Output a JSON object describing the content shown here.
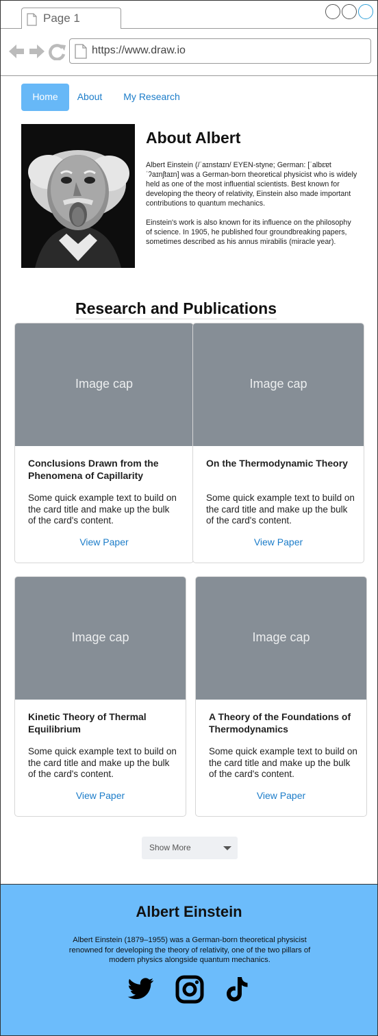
{
  "browser": {
    "tab_label": "Page 1",
    "url": "https://www.draw.io"
  },
  "nav": {
    "items": [
      {
        "label": "Home",
        "active": true
      },
      {
        "label": "About",
        "active": false
      },
      {
        "label": "My Research",
        "active": false
      }
    ]
  },
  "about": {
    "title": "About Albert",
    "paragraph_1": "Albert Einstein (/ˈaɪnstaɪn/ EYEN-styne; German: [ˈalbɛɐt ˈʔaɪnʃtaɪn] was a German-born theoretical physicist who is widely held as one of the most influential scientists. Best known for developing the theory of relativity, Einstein also made important contributions to quantum mechanics.",
    "paragraph_2": "Einstein's work is also known for its influence on the philosophy of science. In 1905, he published four groundbreaking papers, sometimes described as his annus mirabilis (miracle year)."
  },
  "research": {
    "title": "Research and Publications",
    "cards": [
      {
        "image_label": "Image cap",
        "title": "Conclusions Drawn from the Phenomena of Capillarity",
        "text": "Some quick example text to build on the card title and make up the bulk of the card's content.",
        "link": "View Paper"
      },
      {
        "image_label": "Image cap",
        "title": "On the Thermodynamic Theory",
        "text": "Some quick example text to build on the card title and make up the bulk of the card's content.",
        "link": "View Paper"
      },
      {
        "image_label": "Image cap",
        "title": "Kinetic Theory of Thermal Equilibrium",
        "text": "Some quick example text to build on the card title and make up the bulk of the card's content.",
        "link": "View Paper"
      },
      {
        "image_label": "Image cap",
        "title": "A Theory of the Foundations of Thermodynamics",
        "text": "Some quick example text to build on the card title and make up the bulk of the card's content.",
        "link": "View Paper"
      }
    ],
    "show_more": "Show More"
  },
  "footer": {
    "title": "Albert Einstein",
    "text": "Albert Einstein (1879–1955) was a German-born theoretical physicist renowned for developing the theory of relativity, one of the two pillars of modern physics alongside quantum mechanics.",
    "social_icons": [
      "twitter-icon",
      "instagram-icon",
      "tiktok-icon"
    ]
  },
  "colors": {
    "accent": "#67b8f7",
    "link": "#1b7cc9",
    "footer_bg": "#6cbcfb",
    "image_placeholder": "#868e96"
  }
}
